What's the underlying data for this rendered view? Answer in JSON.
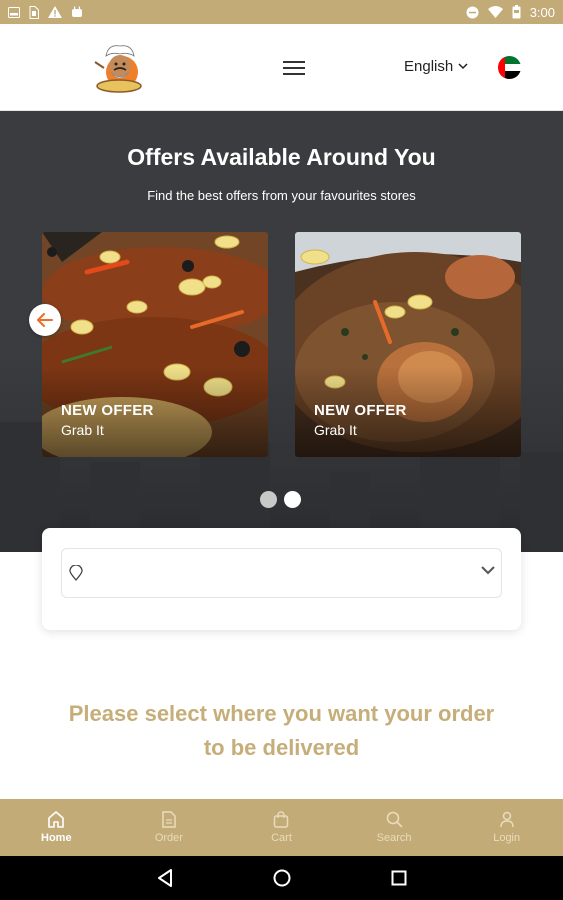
{
  "status_bar": {
    "time": "3:00",
    "icons": [
      "tablet-icon",
      "sim-icon",
      "warning-icon",
      "android-icon",
      "dnd-icon",
      "wifi-icon",
      "battery-icon"
    ]
  },
  "header": {
    "language": "English",
    "logo": "chef-mascot-logo",
    "flag": "uae-flag"
  },
  "hero": {
    "title": "Offers Available Around You",
    "subtitle": "Find the best offers from your favourites stores",
    "offers": [
      {
        "title": "NEW OFFER",
        "subtitle": "Grab It"
      },
      {
        "title": "NEW OFFER",
        "subtitle": "Grab It"
      }
    ],
    "pager": {
      "count": 2,
      "active_index": 1
    }
  },
  "location": {
    "value": ""
  },
  "prompt": {
    "line1": "Please select where you want your order",
    "line2": "to be delivered"
  },
  "bottom_nav": {
    "items": [
      {
        "label": "Home",
        "icon": "home-icon"
      },
      {
        "label": "Order",
        "icon": "order-icon"
      },
      {
        "label": "Cart",
        "icon": "cart-icon"
      },
      {
        "label": "Search",
        "icon": "search-icon"
      },
      {
        "label": "Login",
        "icon": "user-icon"
      }
    ],
    "active": "Home"
  },
  "colors": {
    "brand_gold": "#c2ab77",
    "prompt_gold": "#c5ae79",
    "hero_dark": "#3b3c3f",
    "accent_orange": "#f06a2a"
  }
}
